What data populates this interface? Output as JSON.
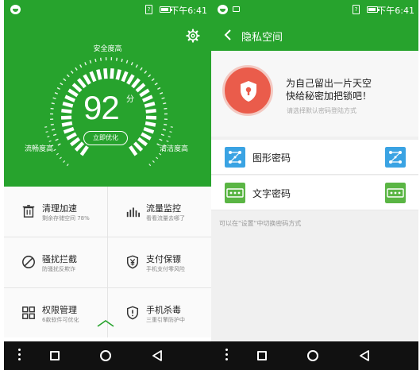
{
  "status_bar": {
    "time": "下午6:41",
    "sim_label": "?"
  },
  "security_home": {
    "safety_label": "安全度高",
    "score": "92",
    "score_unit": "分",
    "optimize_button": "立即优化",
    "smooth_label": "流畅度高",
    "clean_label": "清洁度高",
    "tiles": [
      {
        "title": "清理加速",
        "subtitle": "剩余存储空间 78%",
        "icon": "trash-icon"
      },
      {
        "title": "流量监控",
        "subtitle": "看看流量去哪了",
        "icon": "bar-chart-icon"
      },
      {
        "title": "骚扰拦截",
        "subtitle": "防骚扰反欺诈",
        "icon": "block-icon"
      },
      {
        "title": "支付保镖",
        "subtitle": "手机支付零风险",
        "icon": "yen-shield-icon"
      },
      {
        "title": "权限管理",
        "subtitle": "6款软件可优化",
        "icon": "grid-icon"
      },
      {
        "title": "手机杀毒",
        "subtitle": "三重引擎防护中",
        "icon": "antivirus-shield-icon"
      }
    ]
  },
  "privacy_space": {
    "title": "隐私空间",
    "slogan_line1": "为自己留出一片天空",
    "slogan_line2": "快给秘密加把锁吧！",
    "hint": "请选择默认密码登陆方式",
    "options": [
      {
        "label": "图形密码",
        "icon": "pattern-lock-icon"
      },
      {
        "label": "文字密码",
        "icon": "text-password-icon"
      }
    ],
    "settings_note": "可以在\"设置\"中切换密码方式"
  },
  "colors": {
    "brand_green": "#27a32d",
    "shield_red": "#ea5c4b",
    "pattern_blue": "#3aa3e3",
    "text_green": "#5ab544"
  }
}
